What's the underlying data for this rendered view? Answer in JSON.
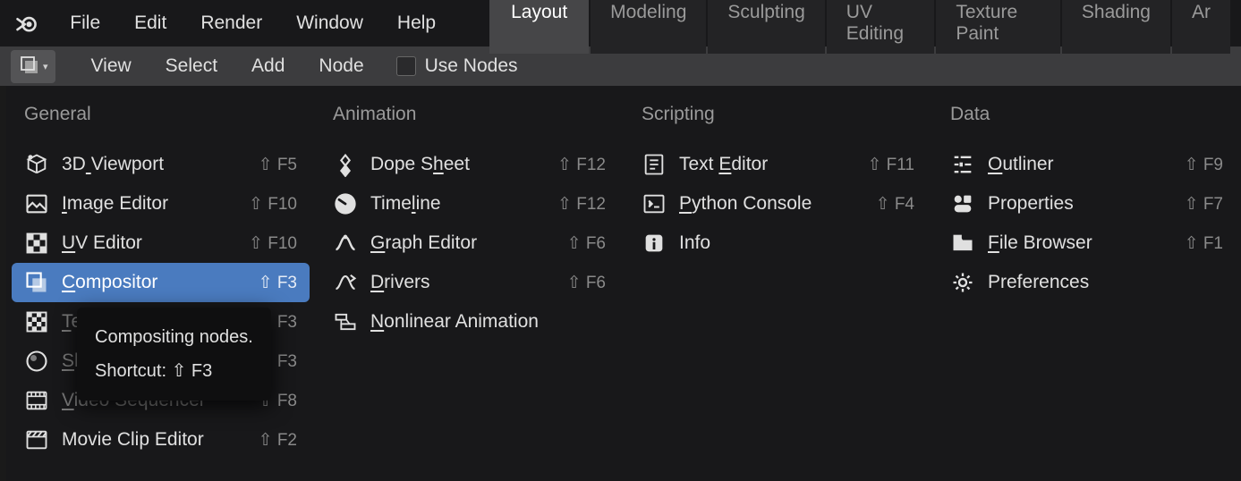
{
  "top_menu": {
    "items": [
      "File",
      "Edit",
      "Render",
      "Window",
      "Help"
    ]
  },
  "workspace_tabs": [
    {
      "label": "Layout",
      "active": true
    },
    {
      "label": "Modeling",
      "active": false
    },
    {
      "label": "Sculpting",
      "active": false
    },
    {
      "label": "UV Editing",
      "active": false
    },
    {
      "label": "Texture Paint",
      "active": false
    },
    {
      "label": "Shading",
      "active": false
    },
    {
      "label": "Ar",
      "active": false
    }
  ],
  "secondary_menu": {
    "items": [
      "View",
      "Select",
      "Add",
      "Node"
    ],
    "use_nodes_label": "Use Nodes"
  },
  "columns": {
    "general": {
      "header": "General",
      "items": [
        {
          "icon": "viewport-icon",
          "label": "3D Viewport",
          "u": 2,
          "shortcut": "⇧ F5",
          "dimmed": false,
          "highlighted": false
        },
        {
          "icon": "image-editor-icon",
          "label": "Image Editor",
          "u": 0,
          "shortcut": "⇧ F10",
          "dimmed": false,
          "highlighted": false
        },
        {
          "icon": "uv-editor-icon",
          "label": "UV Editor",
          "u": 0,
          "shortcut": "⇧ F10",
          "dimmed": false,
          "highlighted": false
        },
        {
          "icon": "compositor-icon",
          "label": "Compositor",
          "u": 0,
          "shortcut": "⇧ F3",
          "dimmed": false,
          "highlighted": true
        },
        {
          "icon": "texture-node-icon",
          "label": "Texture Node Editor",
          "u": 0,
          "shortcut": "⇧ F3",
          "dimmed": true,
          "highlighted": false
        },
        {
          "icon": "shader-editor-icon",
          "label": "Shader Editor",
          "u": 0,
          "shortcut": "⇧ F3",
          "dimmed": true,
          "highlighted": false
        },
        {
          "icon": "video-sequencer-icon",
          "label": "Video Sequencer",
          "u": 0,
          "shortcut": "⇧ F8",
          "dimmed": true,
          "highlighted": false
        },
        {
          "icon": "movie-clip-icon",
          "label": "Movie Clip Editor",
          "u": null,
          "shortcut": "⇧ F2",
          "dimmed": false,
          "highlighted": false
        }
      ]
    },
    "animation": {
      "header": "Animation",
      "items": [
        {
          "icon": "dope-sheet-icon",
          "label": "Dope Sheet",
          "u": 6,
          "shortcut": "⇧ F12",
          "dimmed": false
        },
        {
          "icon": "timeline-icon",
          "label": "Timeline",
          "u": 4,
          "shortcut": "⇧ F12",
          "dimmed": false
        },
        {
          "icon": "graph-editor-icon",
          "label": "Graph Editor",
          "u": 0,
          "shortcut": "⇧ F6",
          "dimmed": false
        },
        {
          "icon": "drivers-icon",
          "label": "Drivers",
          "u": 0,
          "shortcut": "⇧ F6",
          "dimmed": false
        },
        {
          "icon": "nla-icon",
          "label": "Nonlinear Animation",
          "u": 0,
          "shortcut": "",
          "dimmed": false
        }
      ]
    },
    "scripting": {
      "header": "Scripting",
      "items": [
        {
          "icon": "text-editor-icon",
          "label": "Text Editor",
          "u": 5,
          "shortcut": "⇧ F11",
          "dimmed": false
        },
        {
          "icon": "python-console-icon",
          "label": "Python Console",
          "u": 0,
          "shortcut": "⇧ F4",
          "dimmed": false
        },
        {
          "icon": "info-icon",
          "label": "Info",
          "u": null,
          "shortcut": "",
          "dimmed": false
        }
      ]
    },
    "data": {
      "header": "Data",
      "items": [
        {
          "icon": "outliner-icon",
          "label": "Outliner",
          "u": 0,
          "shortcut": "⇧ F9",
          "dimmed": false
        },
        {
          "icon": "properties-icon",
          "label": "Properties",
          "u": null,
          "shortcut": "⇧ F7",
          "dimmed": false
        },
        {
          "icon": "file-browser-icon",
          "label": "File Browser",
          "u": 0,
          "shortcut": "⇧ F1",
          "dimmed": false
        },
        {
          "icon": "preferences-icon",
          "label": "Preferences",
          "u": null,
          "shortcut": "",
          "dimmed": false
        }
      ]
    }
  },
  "tooltip": {
    "line1": "Compositing nodes.",
    "line2": "Shortcut: ⇧ F3"
  }
}
